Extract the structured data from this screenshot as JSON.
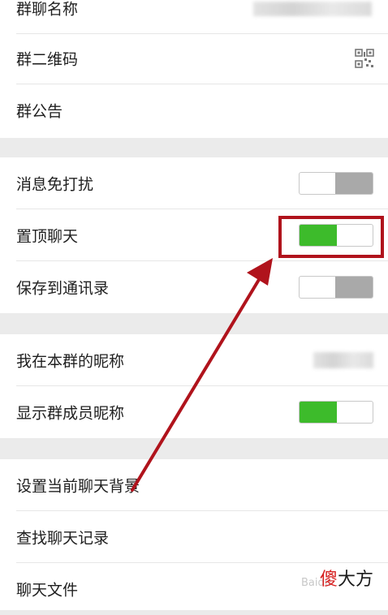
{
  "settings": {
    "group1": {
      "name_label": "群聊名称",
      "qr_label": "群二维码",
      "notice_label": "群公告"
    },
    "group2": {
      "mute_label": "消息免打扰",
      "pin_label": "置顶聊天",
      "save_label": "保存到通讯录"
    },
    "group3": {
      "nickname_label": "我在本群的昵称",
      "show_nick_label": "显示群成员昵称"
    },
    "group4": {
      "background_label": "设置当前聊天背景",
      "search_label": "查找聊天记录",
      "files_label": "聊天文件"
    }
  },
  "toggles": {
    "mute": false,
    "pin": true,
    "save": false,
    "show_nick": true
  },
  "colors": {
    "toggle_on": "#3dbb2b",
    "toggle_off": "#a9a9a9",
    "highlight": "#b0131c"
  },
  "watermark": {
    "char1": "傻",
    "rest": "大方",
    "faint": "Baidu"
  }
}
